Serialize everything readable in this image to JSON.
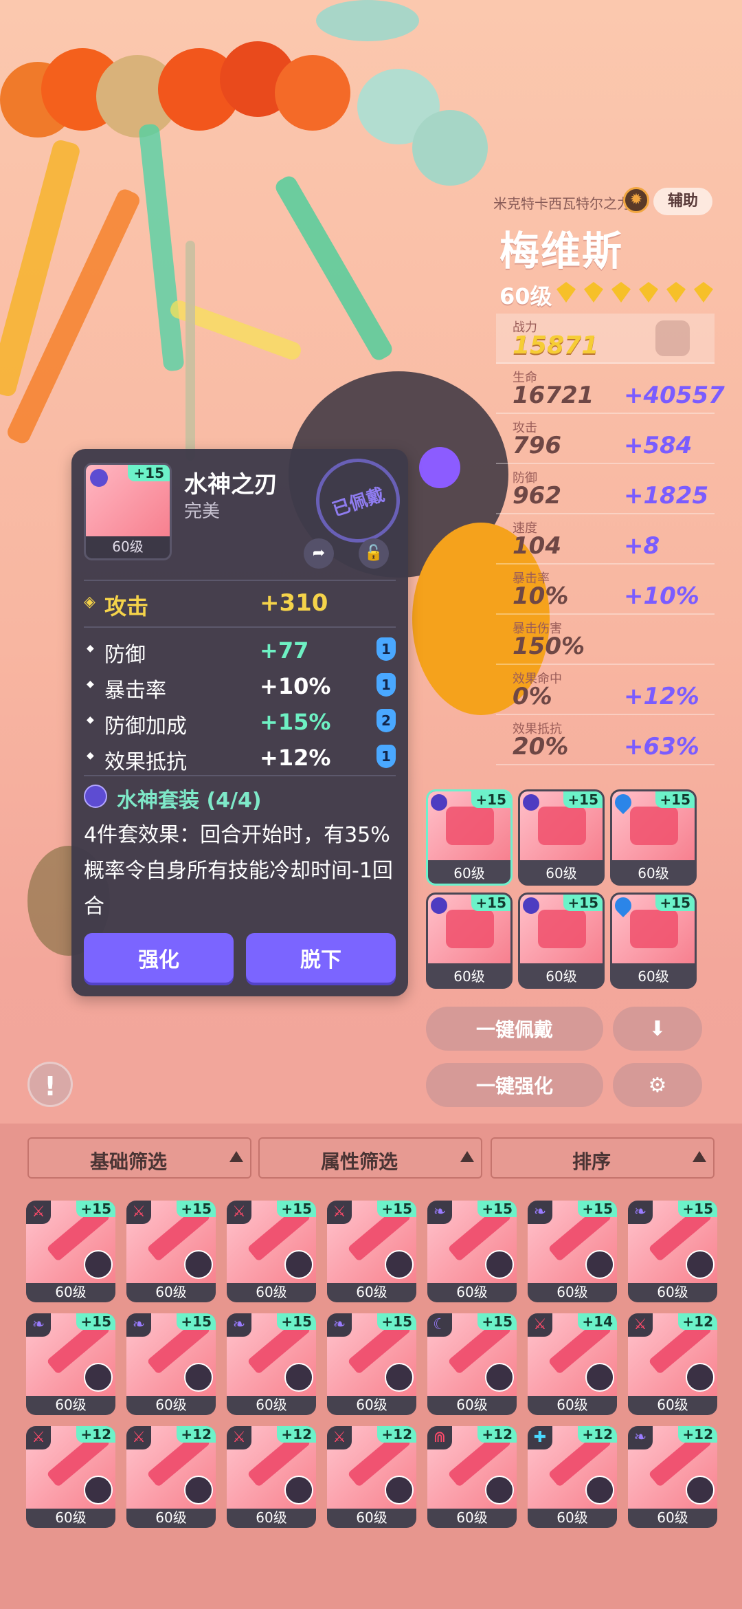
{
  "character": {
    "power_source": "米克特卡西瓦特尔之力",
    "role": "辅助",
    "name": "梅维斯",
    "level": "60级",
    "stars": 6
  },
  "stats": [
    {
      "label": "战力",
      "base": "15871",
      "bonus": ""
    },
    {
      "label": "生命",
      "base": "16721",
      "bonus": "+40557"
    },
    {
      "label": "攻击",
      "base": "796",
      "bonus": "+584"
    },
    {
      "label": "防御",
      "base": "962",
      "bonus": "+1825"
    },
    {
      "label": "速度",
      "base": "104",
      "bonus": "+8"
    },
    {
      "label": "暴击率",
      "base": "10%",
      "bonus": "+10%"
    },
    {
      "label": "暴击伤害",
      "base": "150%",
      "bonus": ""
    },
    {
      "label": "效果命中",
      "base": "0%",
      "bonus": "+12%"
    },
    {
      "label": "效果抵抗",
      "base": "20%",
      "bonus": "+63%"
    }
  ],
  "item": {
    "name": "水神之刃",
    "quality": "完美",
    "plus": "+15",
    "level": "60级",
    "equipped_stamp": "已佩戴",
    "main_stat": {
      "label": "攻击",
      "value": "+310"
    },
    "sub_stats": [
      {
        "label": "防御",
        "value": "+77",
        "count": "1",
        "color": "#6ef0c3"
      },
      {
        "label": "暴击率",
        "value": "+10%",
        "count": "1",
        "color": "#ffffff"
      },
      {
        "label": "防御加成",
        "value": "+15%",
        "count": "2",
        "color": "#6ef0c3"
      },
      {
        "label": "效果抵抗",
        "value": "+12%",
        "count": "1",
        "color": "#ffffff"
      }
    ],
    "set_title": "水神套装 (4/4)",
    "set_desc": "4件套效果：回合开始时，有35%概率令自身所有技能冷却时间-1回合",
    "btn_enhance": "强化",
    "btn_remove": "脱下"
  },
  "equipped_slots": [
    {
      "plus": "+15",
      "level": "60级",
      "set": "moon",
      "active": true
    },
    {
      "plus": "+15",
      "level": "60级",
      "set": "moon",
      "active": false
    },
    {
      "plus": "+15",
      "level": "60级",
      "set": "water",
      "active": false
    },
    {
      "plus": "+15",
      "level": "60级",
      "set": "moon",
      "active": false
    },
    {
      "plus": "+15",
      "level": "60级",
      "set": "moon",
      "active": false
    },
    {
      "plus": "+15",
      "level": "60级",
      "set": "water",
      "active": false
    }
  ],
  "actions": {
    "auto_equip": "一键佩戴",
    "auto_enhance": "一键强化",
    "download_icon": "down-arrow-icon",
    "settings_icon": "gear-icon",
    "warn": "!"
  },
  "filters": {
    "basic": "基础筛选",
    "attribute": "属性筛选",
    "sort": "排序"
  },
  "inventory": [
    {
      "plus": "+15",
      "level": "60级",
      "set_icon": "sword",
      "set_color": "#ff4a6a"
    },
    {
      "plus": "+15",
      "level": "60级",
      "set_icon": "sword",
      "set_color": "#ff4a6a"
    },
    {
      "plus": "+15",
      "level": "60级",
      "set_icon": "sword",
      "set_color": "#ff4a6a"
    },
    {
      "plus": "+15",
      "level": "60级",
      "set_icon": "sword",
      "set_color": "#ff4a6a"
    },
    {
      "plus": "+15",
      "level": "60级",
      "set_icon": "wing",
      "set_color": "#9a7cff"
    },
    {
      "plus": "+15",
      "level": "60级",
      "set_icon": "wing",
      "set_color": "#9a7cff"
    },
    {
      "plus": "+15",
      "level": "60级",
      "set_icon": "wing",
      "set_color": "#9a7cff"
    },
    {
      "plus": "+15",
      "level": "60级",
      "set_icon": "wing",
      "set_color": "#9a7cff"
    },
    {
      "plus": "+15",
      "level": "60级",
      "set_icon": "wing",
      "set_color": "#9a7cff"
    },
    {
      "plus": "+15",
      "level": "60级",
      "set_icon": "wing",
      "set_color": "#9a7cff"
    },
    {
      "plus": "+15",
      "level": "60级",
      "set_icon": "wing",
      "set_color": "#9a7cff"
    },
    {
      "plus": "+15",
      "level": "60级",
      "set_icon": "moon",
      "set_color": "#9a7cff"
    },
    {
      "plus": "+14",
      "level": "60级",
      "set_icon": "sword",
      "set_color": "#ff4a6a"
    },
    {
      "plus": "+12",
      "level": "60级",
      "set_icon": "sword",
      "set_color": "#ff4a6a"
    },
    {
      "plus": "+12",
      "level": "60级",
      "set_icon": "sword",
      "set_color": "#ff4a6a"
    },
    {
      "plus": "+12",
      "level": "60级",
      "set_icon": "sword",
      "set_color": "#ff4a6a"
    },
    {
      "plus": "+12",
      "level": "60级",
      "set_icon": "sword",
      "set_color": "#ff4a6a"
    },
    {
      "plus": "+12",
      "level": "60级",
      "set_icon": "sword",
      "set_color": "#ff4a6a"
    },
    {
      "plus": "+12",
      "level": "60级",
      "set_icon": "fang",
      "set_color": "#ff4a6a"
    },
    {
      "plus": "+12",
      "level": "60级",
      "set_icon": "cross",
      "set_color": "#4ad8ff"
    },
    {
      "plus": "+12",
      "level": "60级",
      "set_icon": "wing",
      "set_color": "#9a7cff"
    }
  ]
}
